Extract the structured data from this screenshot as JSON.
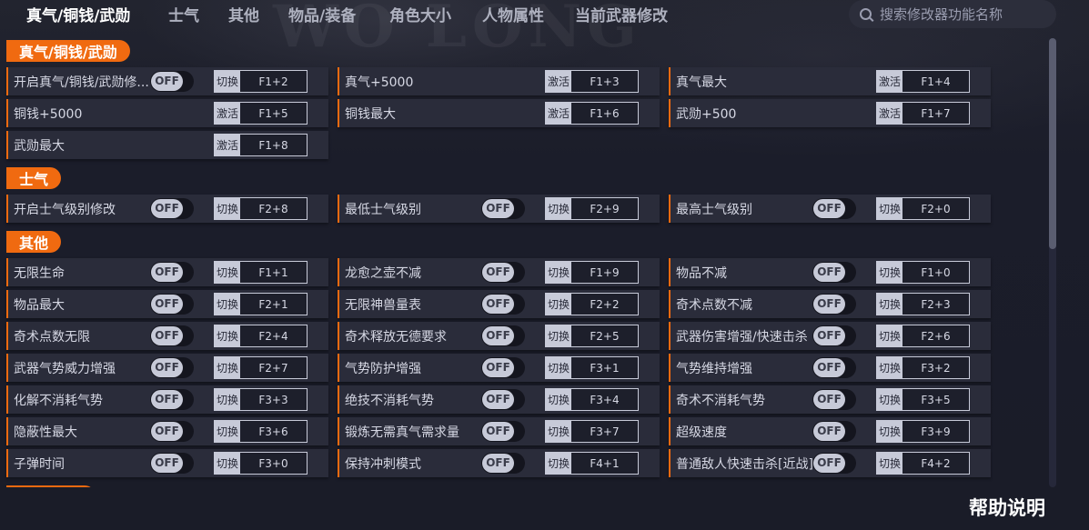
{
  "nav": {
    "tabs": [
      "真气/铜钱/武勋",
      "士气",
      "其他",
      "物品/装备",
      "角色大小",
      "人物属性",
      "当前武器修改"
    ],
    "active_tab": 0
  },
  "search": {
    "placeholder": "搜索修改器功能名称",
    "value": ""
  },
  "sections": [
    {
      "title": "真气/铜钱/武勋",
      "items": [
        {
          "label": "开启真气/铜钱/武勋修...",
          "toggle": "OFF",
          "mode": "切换",
          "key": "F1+2"
        },
        {
          "label": "真气+5000",
          "toggle": null,
          "mode": "激活",
          "key": "F1+3"
        },
        {
          "label": "真气最大",
          "toggle": null,
          "mode": "激活",
          "key": "F1+4"
        },
        {
          "label": "铜钱+5000",
          "toggle": null,
          "mode": "激活",
          "key": "F1+5"
        },
        {
          "label": "铜钱最大",
          "toggle": null,
          "mode": "激活",
          "key": "F1+6"
        },
        {
          "label": "武勋+500",
          "toggle": null,
          "mode": "激活",
          "key": "F1+7"
        },
        {
          "label": "武勋最大",
          "toggle": null,
          "mode": "激活",
          "key": "F1+8"
        }
      ]
    },
    {
      "title": "士气",
      "items": [
        {
          "label": "开启士气级别修改",
          "toggle": "OFF",
          "mode": "切换",
          "key": "F2+8"
        },
        {
          "label": "最低士气级别",
          "toggle": "OFF",
          "mode": "切换",
          "key": "F2+9"
        },
        {
          "label": "最高士气级别",
          "toggle": "OFF",
          "mode": "切换",
          "key": "F2+0"
        }
      ]
    },
    {
      "title": "其他",
      "items": [
        {
          "label": "无限生命",
          "toggle": "OFF",
          "mode": "切换",
          "key": "F1+1"
        },
        {
          "label": "龙愈之壶不减",
          "toggle": "OFF",
          "mode": "切换",
          "key": "F1+9"
        },
        {
          "label": "物品不减",
          "toggle": "OFF",
          "mode": "切换",
          "key": "F1+0"
        },
        {
          "label": "物品最大",
          "toggle": "OFF",
          "mode": "切换",
          "key": "F2+1"
        },
        {
          "label": "无限神兽量表",
          "toggle": "OFF",
          "mode": "切换",
          "key": "F2+2"
        },
        {
          "label": "奇术点数不减",
          "toggle": "OFF",
          "mode": "切换",
          "key": "F2+3"
        },
        {
          "label": "奇术点数无限",
          "toggle": "OFF",
          "mode": "切换",
          "key": "F2+4"
        },
        {
          "label": "奇术释放无德要求",
          "toggle": "OFF",
          "mode": "切换",
          "key": "F2+5"
        },
        {
          "label": "武器伤害增强/快速击杀",
          "toggle": "OFF",
          "mode": "切换",
          "key": "F2+6"
        },
        {
          "label": "武器气势威力增强",
          "toggle": "OFF",
          "mode": "切换",
          "key": "F2+7"
        },
        {
          "label": "气势防护增强",
          "toggle": "OFF",
          "mode": "切换",
          "key": "F3+1"
        },
        {
          "label": "气势维持增强",
          "toggle": "OFF",
          "mode": "切换",
          "key": "F3+2"
        },
        {
          "label": "化解不消耗气势",
          "toggle": "OFF",
          "mode": "切换",
          "key": "F3+3"
        },
        {
          "label": "绝技不消耗气势",
          "toggle": "OFF",
          "mode": "切换",
          "key": "F3+4"
        },
        {
          "label": "奇术不消耗气势",
          "toggle": "OFF",
          "mode": "切换",
          "key": "F3+5"
        },
        {
          "label": "隐蔽性最大",
          "toggle": "OFF",
          "mode": "切换",
          "key": "F3+6"
        },
        {
          "label": "锻炼无需真气需求量",
          "toggle": "OFF",
          "mode": "切换",
          "key": "F3+7"
        },
        {
          "label": "超级速度",
          "toggle": "OFF",
          "mode": "切换",
          "key": "F3+9"
        },
        {
          "label": "子弹时间",
          "toggle": "OFF",
          "mode": "切换",
          "key": "F3+0"
        },
        {
          "label": "保持冲刺模式",
          "toggle": "OFF",
          "mode": "切换",
          "key": "F4+1"
        },
        {
          "label": "普通敌人快速击杀[近战]",
          "toggle": "OFF",
          "mode": "切换",
          "key": "F4+2"
        }
      ]
    },
    {
      "title": "物品/装备",
      "items": []
    }
  ],
  "help_label": "帮助说明",
  "watermark": "WO LONG",
  "colors": {
    "accent": "#f06a10",
    "background": "#1b1d2a",
    "row": "#2a2c3a"
  }
}
